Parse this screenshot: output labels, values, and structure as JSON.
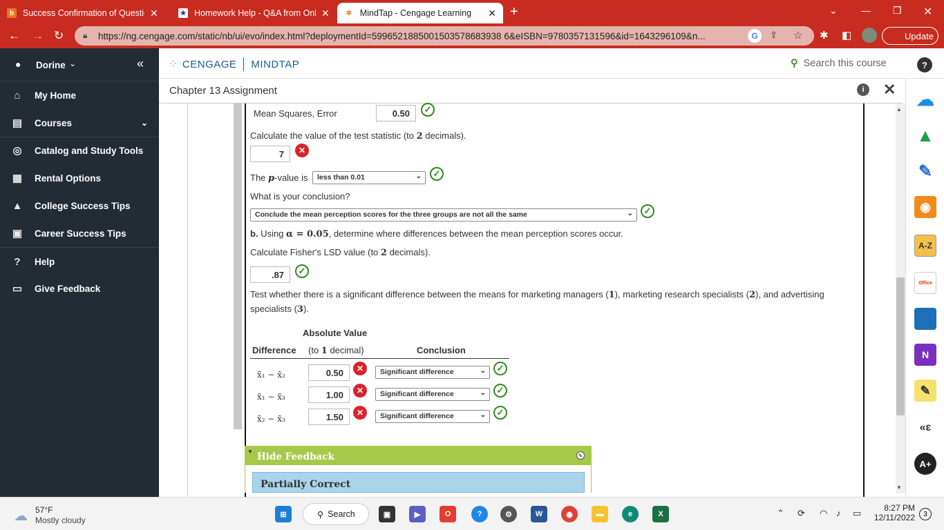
{
  "browser": {
    "tabs": [
      {
        "label": "Success Confirmation of Questio",
        "fav": "b",
        "active": false
      },
      {
        "label": "Homework Help - Q&A from Onl",
        "fav": "★",
        "active": false
      },
      {
        "label": "MindTap - Cengage Learning",
        "fav": "✲",
        "active": true
      }
    ],
    "url": "https://ng.cengage.com/static/nb/ui/evo/index.html?deploymentId=5996521885001503578683938 6&eISBN=9780357131596&id=1643296109&n...",
    "update_label": "Update"
  },
  "sidebar": {
    "user": "Dorine",
    "items": [
      {
        "label": "My Home",
        "icon": "home-icon"
      },
      {
        "label": "Courses",
        "icon": "book-icon"
      },
      {
        "label": "Catalog and Study Tools",
        "icon": "compass-icon"
      },
      {
        "label": "Rental Options",
        "icon": "rental-icon"
      },
      {
        "label": "College Success Tips",
        "icon": "graduation-cap-icon"
      },
      {
        "label": "Career Success Tips",
        "icon": "briefcase-icon"
      },
      {
        "label": "Help",
        "icon": "question-icon"
      },
      {
        "label": "Give Feedback",
        "icon": "feedback-icon"
      }
    ]
  },
  "header": {
    "brand_left": "CENGAGE",
    "brand_right": "MINDTAP",
    "search_placeholder": "Search this course",
    "help": "?",
    "assignment_title": "Chapter 13 Assignment"
  },
  "question": {
    "mse_label": "Mean Squares, Error",
    "mse_value": "0.50",
    "test_stat_prompt_a": "Calculate the value of the test statistic (to ",
    "test_stat_prompt_n": "2",
    "test_stat_prompt_b": " decimals).",
    "test_stat_value": "7",
    "pvalue_prefix": "The ",
    "pvalue_p": "p",
    "pvalue_suffix": "-value is",
    "pvalue_selected": "less than 0.01",
    "conclusion_prompt": "What is your conclusion?",
    "conclusion_selected": "Conclude the mean perception scores for the three groups are not all the same",
    "part_b_label": "b.",
    "part_b_a": " Using ",
    "part_b_alpha": "α = 0.05",
    "part_b_b": ", determine where differences between the mean perception scores occur.",
    "lsd_prompt_a": "Calculate Fisher's LSD value (to ",
    "lsd_prompt_n": "2",
    "lsd_prompt_b": " decimals).",
    "lsd_value": ".87",
    "test_line1_a": "Test whether there is a significant difference between the means for marketing managers (",
    "test_line1_n1": "1",
    "test_line1_b": "), marketing research specialists (",
    "test_line1_n2": "2",
    "test_line1_c": "), and advertising",
    "test_line2_a": "specialists (",
    "test_line2_n3": "3",
    "test_line2_b": ").",
    "table": {
      "header_abs": "Absolute Value",
      "header_diff": "Difference",
      "header_to_a": "(to ",
      "header_to_n": "1",
      "header_to_b": " decimal)",
      "header_conclusion": "Conclusion",
      "rows": [
        {
          "diff": "x̄₁ − x̄₂",
          "value": "0.50",
          "conclusion": "Significant difference"
        },
        {
          "diff": "x̄₁ − x̄₃",
          "value": "1.00",
          "conclusion": "Significant difference"
        },
        {
          "diff": "x̄₂ − x̄₃",
          "value": "1.50",
          "conclusion": "Significant difference"
        }
      ]
    },
    "hide_feedback": "Hide Feedback",
    "partially_correct": "Partially Correct"
  },
  "taskbar": {
    "temp": "57°F",
    "weather": "Mostly cloudy",
    "search": "Search",
    "time": "8:27 PM",
    "date": "12/11/2022",
    "notifications": "3"
  },
  "colors": {
    "chrome_red": "#c82b1f",
    "sidebar_bg": "#232b35",
    "correct_green": "#2f8b1c",
    "wrong_red": "#d9232d",
    "feedback_green": "#a6c94a",
    "partial_blue": "#a9d4ea"
  }
}
